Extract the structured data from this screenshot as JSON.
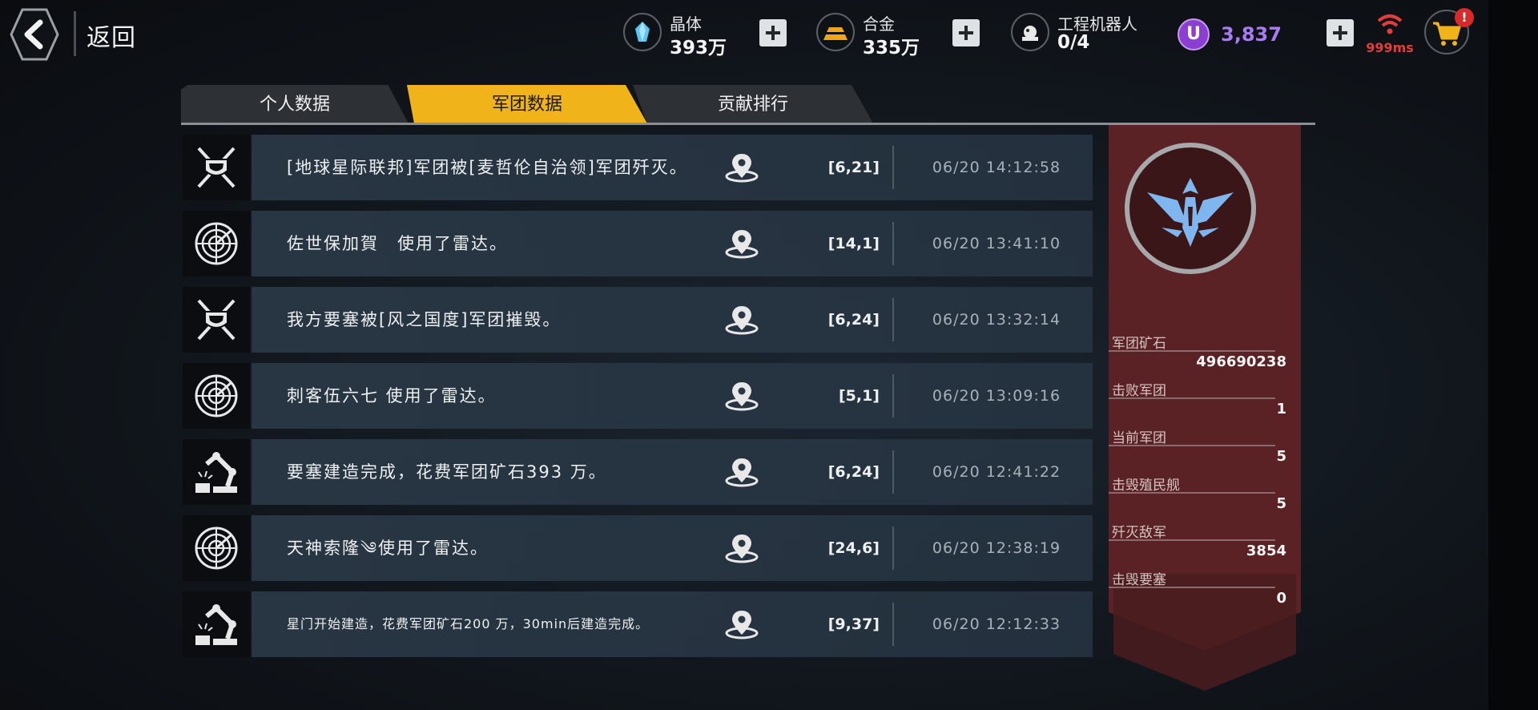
{
  "topbar": {
    "back_label": "返回",
    "resources": [
      {
        "name": "晶体",
        "value": "393万",
        "icon": "crystal-icon"
      },
      {
        "name": "合金",
        "value": "335万",
        "icon": "alloy-icon"
      },
      {
        "name": "工程机器人",
        "value": "0/4",
        "icon": "robot-icon"
      }
    ],
    "currency": {
      "symbol": "U",
      "value": "3,837"
    },
    "ping": "999ms",
    "cart_badge": "!"
  },
  "tabs": [
    {
      "label": "个人数据",
      "active": false
    },
    {
      "label": "军团数据",
      "active": true
    },
    {
      "label": "贡献排行",
      "active": false
    }
  ],
  "events": [
    {
      "icon": "sword-shield-icon",
      "text": "[地球星际联邦]军团被[麦哲伦自治领]军团歼灭。",
      "coord": "[6,21]",
      "time": "06/20 14:12:58"
    },
    {
      "icon": "radar-icon",
      "text": "佐世保加賀　使用了雷达。",
      "coord": "[14,1]",
      "time": "06/20 13:41:10"
    },
    {
      "icon": "sword-shield-icon",
      "text": "我方要塞被[风之国度]军团摧毁。",
      "coord": "[6,24]",
      "time": "06/20 13:32:14"
    },
    {
      "icon": "radar-icon",
      "text": "刺客伍六七 使用了雷达。",
      "coord": "[5,1]",
      "time": "06/20 13:09:16"
    },
    {
      "icon": "robot-arm-icon",
      "text": "要塞建造完成，花费军团矿石393 万。",
      "coord": "[6,24]",
      "time": "06/20 12:41:22"
    },
    {
      "icon": "radar-icon",
      "text": "天神索隆༄使用了雷达。",
      "coord": "[24,6]",
      "time": "06/20 12:38:19"
    },
    {
      "icon": "robot-arm-icon",
      "text": "星门开始建造，花费军团矿石200 万，30min后建造完成。",
      "coord": "[9,37]",
      "time": "06/20 12:12:33",
      "small": true
    }
  ],
  "legion": {
    "stats": [
      {
        "label": "军团矿石",
        "value": "496690238"
      },
      {
        "label": "击败军团",
        "value": "1"
      },
      {
        "label": "当前军团",
        "value": "5"
      },
      {
        "label": "击毁殖民舰",
        "value": "5"
      },
      {
        "label": "歼灭敌军",
        "value": "3854"
      },
      {
        "label": "击毁要塞",
        "value": "0"
      }
    ]
  },
  "colors": {
    "accent_tab": "#f0b319",
    "panel": "#5a2224",
    "currency": "#a77cf0",
    "ping": "#e23c3c",
    "emblem": "#7fb6ef"
  }
}
